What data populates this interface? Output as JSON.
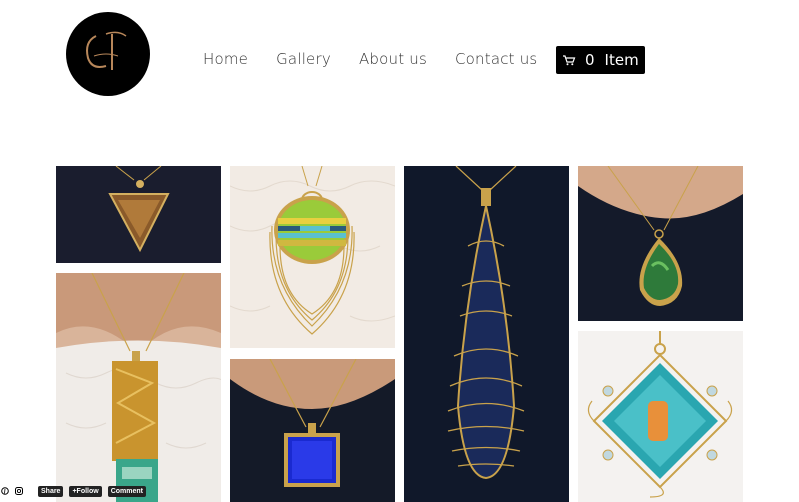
{
  "nav": {
    "items": [
      {
        "label": "Home"
      },
      {
        "label": "Gallery"
      },
      {
        "label": "About us"
      },
      {
        "label": "Contact us"
      }
    ]
  },
  "cart": {
    "count": "0",
    "label": "Item",
    "icon": "cart-icon"
  },
  "social": {
    "share": "Share",
    "follow": "+Follow",
    "comment": "Comment",
    "icons": [
      "pinterest-icon",
      "instagram-icon"
    ]
  },
  "gallery": {
    "items": [
      {
        "name": "tigers-eye-pendant"
      },
      {
        "name": "striped-glass-pendant"
      },
      {
        "name": "long-wire-teardrop-pendant"
      },
      {
        "name": "green-glass-pendant"
      },
      {
        "name": "gold-foil-bar-pendant"
      },
      {
        "name": "blue-square-pendant"
      },
      {
        "name": "turquoise-diamond-pendant"
      }
    ]
  },
  "colors": {
    "accent": "#000000",
    "text": "#333333",
    "gold": "#c9a24b"
  }
}
